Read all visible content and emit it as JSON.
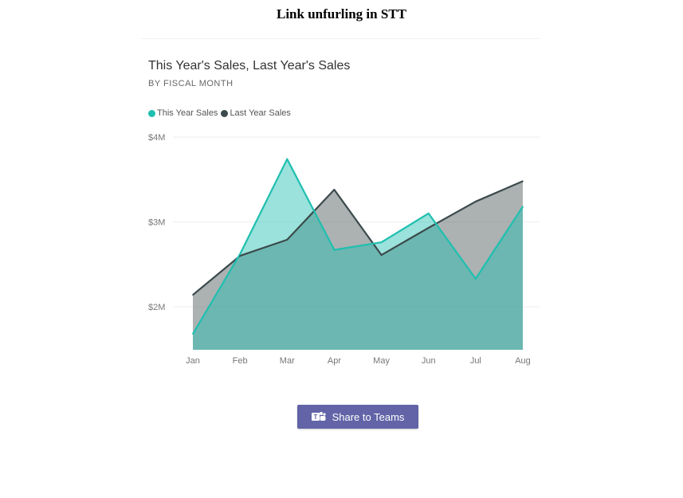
{
  "page": {
    "title": "Link unfurling in STT"
  },
  "share_button": {
    "label": "Share to Teams",
    "icon": "teams-icon"
  },
  "colors": {
    "this_year": "#1fbfb0",
    "last_year": "#3b4a4c",
    "button": "#6264a7"
  },
  "chart_data": {
    "type": "area",
    "title": "This Year's Sales, Last Year's Sales",
    "subtitle": "BY FISCAL MONTH",
    "categories": [
      "Jan",
      "Feb",
      "Mar",
      "Apr",
      "May",
      "Jun",
      "Jul",
      "Aug"
    ],
    "series": [
      {
        "name": "This Year Sales",
        "values": [
          1.68,
          2.62,
          3.74,
          2.67,
          2.76,
          3.1,
          2.33,
          3.18
        ],
        "color": "#1fbfb0"
      },
      {
        "name": "Last Year Sales",
        "values": [
          2.14,
          2.6,
          2.79,
          3.38,
          2.61,
          2.93,
          3.24,
          3.48
        ],
        "color": "#3b4a4c"
      }
    ],
    "yticks": [
      "$4M",
      "$3M",
      "$2M"
    ],
    "ytick_values": [
      4,
      3,
      2
    ],
    "ylim": [
      1.5,
      4.0
    ],
    "grid": true,
    "legend": "top-left"
  }
}
